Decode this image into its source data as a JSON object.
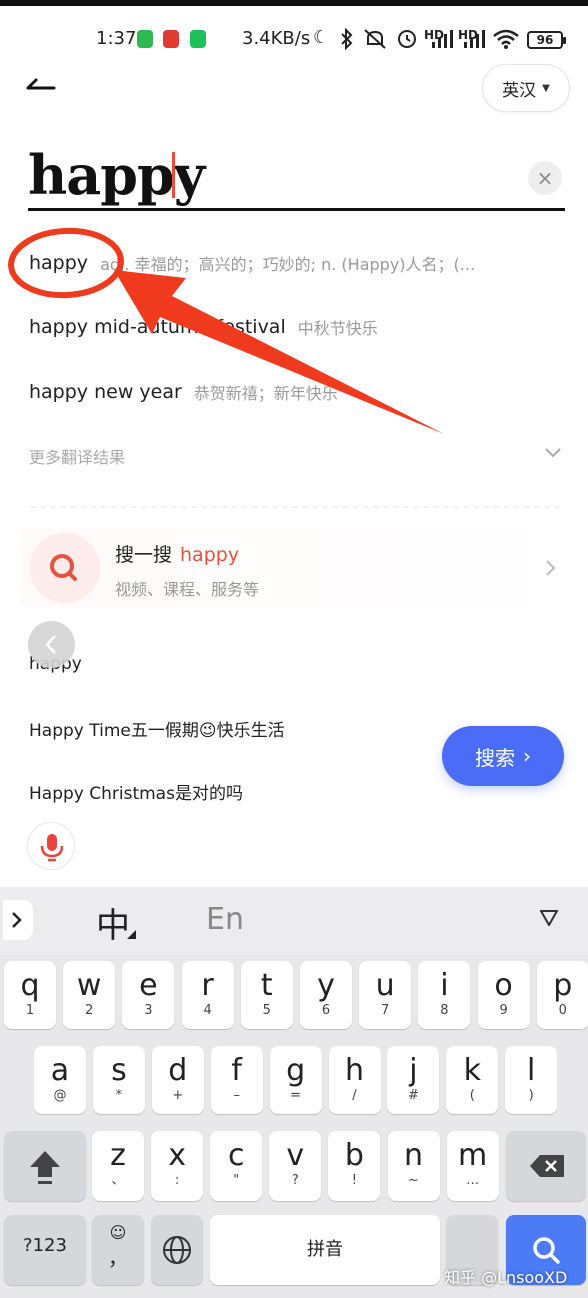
{
  "status_bar": {
    "time": "1:37",
    "network_speed": "3.4KB/s",
    "hd1": "HD",
    "hd2": "HD",
    "battery": "96"
  },
  "header": {
    "language_toggle": "英汉"
  },
  "search": {
    "query": "happy",
    "clear": "×"
  },
  "suggestions": [
    {
      "word": "happy",
      "definition": "adj. 幸福的；高兴的；巧妙的; n. (Happy)人名；(..."
    },
    {
      "word": "happy mid-autumn festival",
      "definition": "中秋节快乐"
    },
    {
      "word": "happy new year",
      "definition": "恭贺新禧；新年快乐"
    }
  ],
  "more_results": "更多翻译结果",
  "search_card": {
    "title": "搜一搜",
    "highlight": "happy",
    "subtitle": "视频、课程、服务等"
  },
  "history": [
    "happy",
    "Happy Time五一假期😉快乐生活",
    "Happy Christmas是对的吗"
  ],
  "search_button": {
    "label": "搜索",
    "arrow": "›"
  },
  "keyboard": {
    "lang_cn": "中",
    "lang_en": "En",
    "row1": [
      {
        "k": "q",
        "s": "1"
      },
      {
        "k": "w",
        "s": "2"
      },
      {
        "k": "e",
        "s": "3"
      },
      {
        "k": "r",
        "s": "4"
      },
      {
        "k": "t",
        "s": "5"
      },
      {
        "k": "y",
        "s": "6"
      },
      {
        "k": "u",
        "s": "7"
      },
      {
        "k": "i",
        "s": "8"
      },
      {
        "k": "o",
        "s": "9"
      },
      {
        "k": "p",
        "s": "0"
      }
    ],
    "row2": [
      {
        "k": "a",
        "s": "@"
      },
      {
        "k": "s",
        "s": "*"
      },
      {
        "k": "d",
        "s": "+"
      },
      {
        "k": "f",
        "s": "–"
      },
      {
        "k": "g",
        "s": "="
      },
      {
        "k": "h",
        "s": "/"
      },
      {
        "k": "j",
        "s": "#"
      },
      {
        "k": "k",
        "s": "("
      },
      {
        "k": "l",
        "s": ")"
      }
    ],
    "row3": [
      {
        "k": "z",
        "s": "、"
      },
      {
        "k": "x",
        "s": ":"
      },
      {
        "k": "c",
        "s": "\""
      },
      {
        "k": "v",
        "s": "?"
      },
      {
        "k": "b",
        "s": "!"
      },
      {
        "k": "n",
        "s": "~"
      },
      {
        "k": "m",
        "s": "…"
      }
    ],
    "num_key": "?123",
    "emoji_comma": "，",
    "space": "拼音"
  },
  "watermark": "知乎 @LnsooXD",
  "colors": {
    "accent_blue": "#4a6cf7",
    "annotation_red": "#f03a1e",
    "highlight_red": "#e5533f"
  }
}
